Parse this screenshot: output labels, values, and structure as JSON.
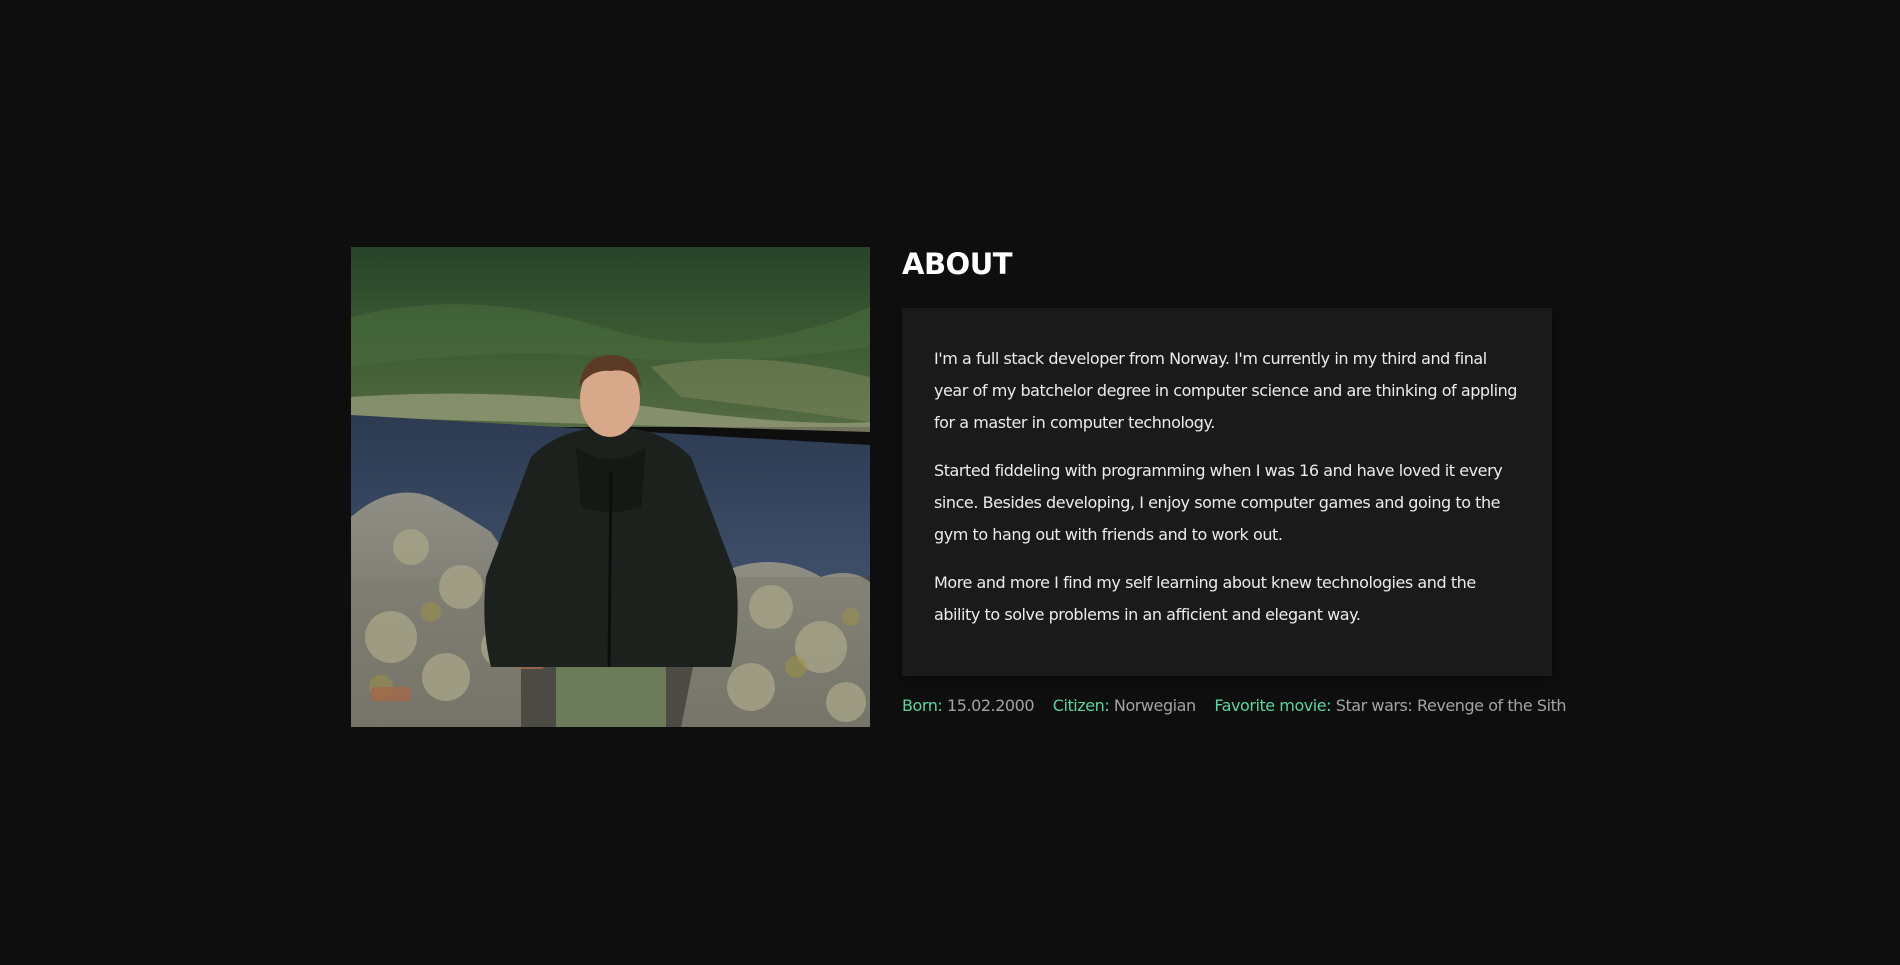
{
  "about": {
    "title": "ABOUT",
    "paragraphs": [
      "I'm a full stack developer from Norway. I'm currently in my third and final year of my batchelor degree in computer science and are thinking of appling for a master in computer technology.",
      "Started fiddeling with programming when I was 16 and have loved it every since. Besides developing, I enjoy some computer games and going to the gym to hang out with friends and to work out.",
      "More and more I find my self learning about knew technologies and the ability to solve problems in an afficient and elegant way."
    ],
    "facts": [
      {
        "label": "Born:",
        "value": "15.02.2000"
      },
      {
        "label": "Citizen:",
        "value": "Norwegian"
      },
      {
        "label": "Favorite movie:",
        "value": "Star wars: Revenge of the Sith"
      }
    ]
  },
  "colors": {
    "background": "#0e0e0f",
    "card": "#1a1a1b",
    "accent": "#5fd39c",
    "muted_text": "#a3a3a3"
  }
}
